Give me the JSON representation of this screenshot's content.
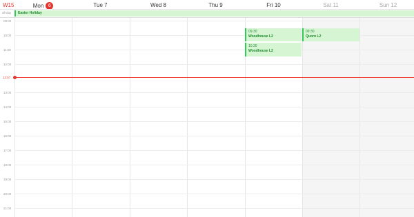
{
  "header": {
    "week_label": "W15",
    "days": [
      {
        "label": "Mon",
        "date": "6",
        "today": true
      },
      {
        "label": "Tue 7"
      },
      {
        "label": "Wed 8"
      },
      {
        "label": "Thu 9"
      },
      {
        "label": "Fri 10"
      },
      {
        "label": "Sat 11",
        "weekend": true
      },
      {
        "label": "Sun 12",
        "weekend": true
      }
    ]
  },
  "all_day": {
    "label": "all-day",
    "event": "Easter Holiday"
  },
  "hours": [
    "09:00",
    "10:00",
    "11:00",
    "12:00",
    "13:00",
    "14:00",
    "15:00",
    "16:00",
    "17:00",
    "18:00",
    "19:00",
    "20:00",
    "21:00",
    "22:00",
    "23:00"
  ],
  "now": {
    "label": "12:57"
  },
  "events": [
    {
      "day": "Fri 10",
      "time": "09:30",
      "title": "Woodhouse L2"
    },
    {
      "day": "Fri 10",
      "time": "10:30",
      "title": "Woodhouse L2"
    },
    {
      "day": "Sat 11",
      "time": "09:30",
      "title": "Quorn L2"
    }
  ],
  "colors": {
    "accent": "#e2362e",
    "event_bg": "#d6f5d3",
    "event_border": "#34c759",
    "event_text": "#1c8a2b"
  }
}
